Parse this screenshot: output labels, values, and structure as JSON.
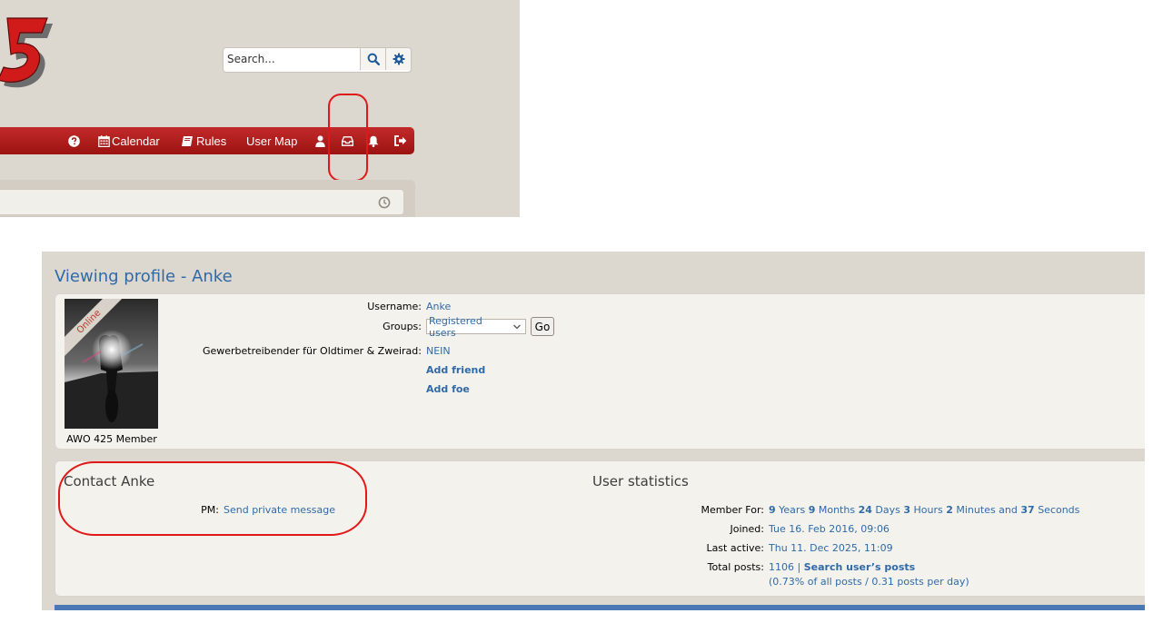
{
  "header": {
    "logo_icon": "brand-logo-5",
    "search": {
      "placeholder": "Search...",
      "search_icon": "search-icon",
      "advanced_icon": "gear-icon"
    }
  },
  "navbar": {
    "items": [
      {
        "icon": "question-icon",
        "label": ""
      },
      {
        "icon": "calendar-icon",
        "label": "Calendar"
      },
      {
        "icon": "book-icon",
        "label": "Rules"
      },
      {
        "icon": "",
        "label": "User Map"
      },
      {
        "icon": "user-icon",
        "label": ""
      },
      {
        "icon": "inbox-icon",
        "label": ""
      },
      {
        "icon": "bell-icon",
        "label": ""
      },
      {
        "icon": "logout-icon",
        "label": ""
      }
    ],
    "accent_color": "#b01c1c"
  },
  "subbar": {
    "icon": "clock-icon"
  },
  "profile": {
    "title": "Viewing profile - Anke",
    "online_badge": "Online",
    "rank": "AWO 425 Member",
    "fields": {
      "username_label": "Username:",
      "username_value": "Anke",
      "groups_label": "Groups:",
      "groups_selected": "Registered users",
      "go_label": "Go",
      "business_label": "Gewerbetreibender für Oldtimer & Zweirad:",
      "business_value": "NEIN",
      "add_friend": "Add friend",
      "add_foe": "Add foe"
    }
  },
  "contact": {
    "title": "Contact Anke",
    "pm_label": "PM:",
    "pm_link": "Send private message"
  },
  "stats": {
    "title": "User statistics",
    "member_for_label": "Member For:",
    "member_for": [
      {
        "n": "9",
        "u": "Years"
      },
      {
        "n": "9",
        "u": "Months"
      },
      {
        "n": "24",
        "u": "Days"
      },
      {
        "n": "3",
        "u": "Hours"
      },
      {
        "n": "2",
        "u": "Minutes and"
      },
      {
        "n": "37",
        "u": "Seconds"
      }
    ],
    "joined_label": "Joined:",
    "joined": "Tue 16. Feb 2016, 09:06",
    "last_active_label": "Last active:",
    "last_active": "Thu 11. Dec 2025, 11:09",
    "total_posts_label": "Total posts:",
    "total_posts": "1106",
    "separator": "|",
    "search_posts": "Search user’s posts",
    "posts_ratio": "(0.73% of all posts / 0.31 posts per day)"
  },
  "annotation_color": "#e01818"
}
